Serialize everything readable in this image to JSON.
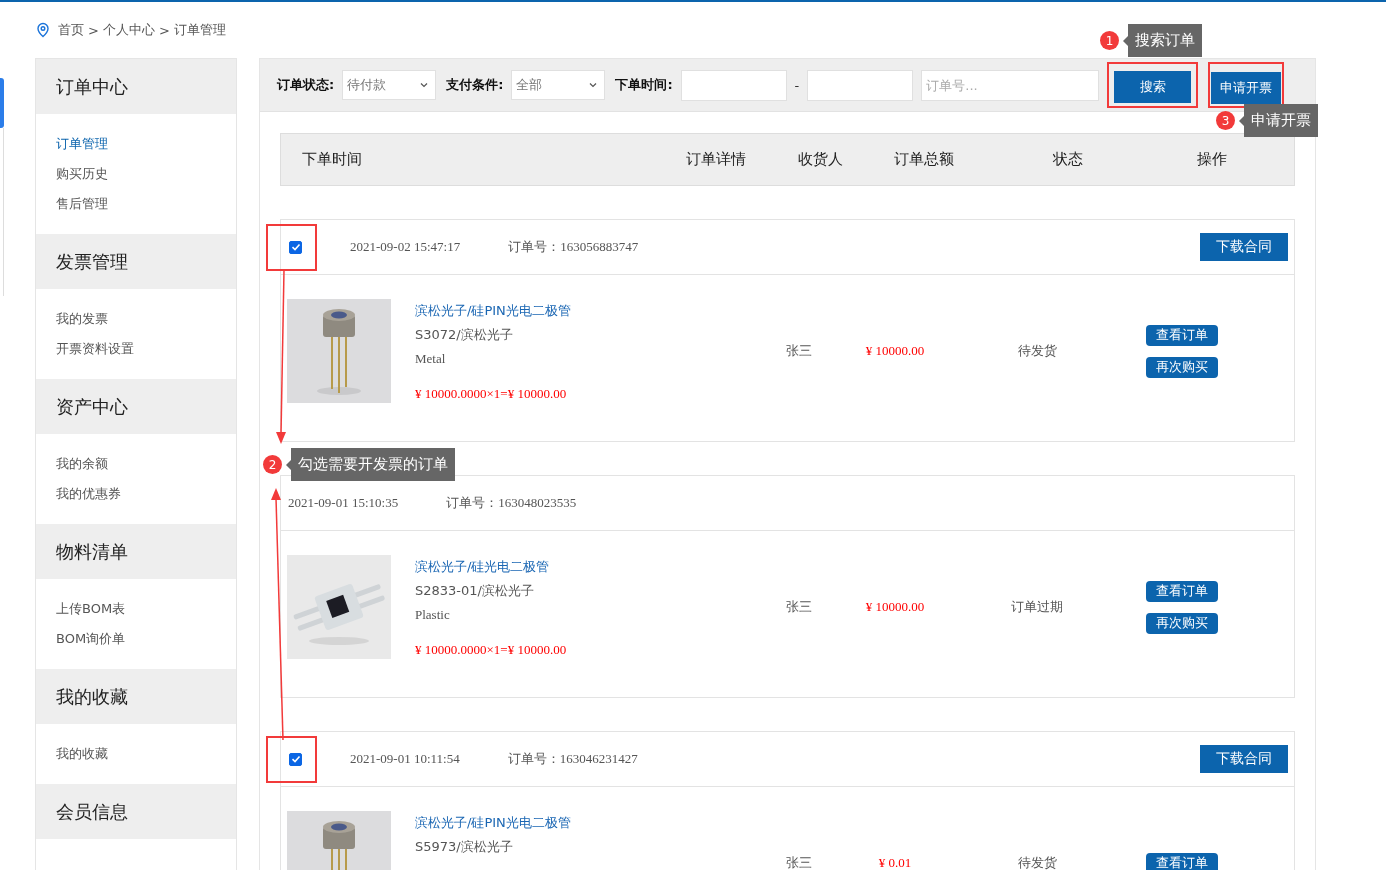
{
  "breadcrumb": {
    "separator": ">",
    "items": [
      "首页",
      "个人中心",
      "订单管理"
    ]
  },
  "sidebar": {
    "sections": [
      {
        "title": "订单中心",
        "items": [
          {
            "label": "订单管理",
            "selected": true
          },
          {
            "label": "购买历史",
            "selected": false
          },
          {
            "label": "售后管理",
            "selected": false
          }
        ]
      },
      {
        "title": "发票管理",
        "items": [
          {
            "label": "我的发票",
            "selected": false
          },
          {
            "label": "开票资料设置",
            "selected": false
          }
        ]
      },
      {
        "title": "资产中心",
        "items": [
          {
            "label": "我的余额",
            "selected": false
          },
          {
            "label": "我的优惠券",
            "selected": false
          }
        ]
      },
      {
        "title": "物料清单",
        "items": [
          {
            "label": "上传BOM表",
            "selected": false
          },
          {
            "label": "BOM询价单",
            "selected": false
          }
        ]
      },
      {
        "title": "我的收藏",
        "items": [
          {
            "label": "我的收藏",
            "selected": false
          }
        ]
      },
      {
        "title": "会员信息"
      }
    ]
  },
  "filters": [
    {
      "kind": "select",
      "label": "订单状态:",
      "value": "待付款"
    },
    {
      "kind": "select",
      "label": "支付条件:",
      "value": "全部"
    },
    {
      "kind": "daterange",
      "label": "下单时间:",
      "separator": "-"
    },
    {
      "kind": "text",
      "placeholder": "订单号..."
    }
  ],
  "search_button": {
    "label": "搜索",
    "highlighted": true
  },
  "apply_button": {
    "label": "申请开票",
    "highlighted": true
  },
  "columns": [
    "下单时间",
    "订单详情",
    "收货人",
    "订单总额",
    "状态",
    "操作"
  ],
  "orders": [
    {
      "checkbox": {
        "checked": true,
        "highlighted": true
      },
      "time": "2021-09-02 15:47:17",
      "order_no_label": "订单号：",
      "order_no": "163056883747",
      "download_button": "下载合同",
      "product": {
        "name": "滨松光子/硅PIN光电二极管",
        "model": "S3072/滨松光子",
        "material": "Metal",
        "price_line": "¥ 10000.0000×1=¥ 10000.00"
      },
      "receiver": "张三",
      "total": "¥ 10000.00",
      "status": "待发货",
      "actions": [
        "查看订单",
        "再次购买"
      ]
    },
    {
      "time": "2021-09-01 15:10:35",
      "order_no_label": "订单号：",
      "order_no": "163048023535",
      "product": {
        "name": "滨松光子/硅光电二极管",
        "model": "S2833-01/滨松光子",
        "material": "Plastic",
        "price_line": "¥ 10000.0000×1=¥ 10000.00"
      },
      "receiver": "张三",
      "total": "¥ 10000.00",
      "status": "订单过期",
      "actions": [
        "查看订单",
        "再次购买"
      ]
    },
    {
      "checkbox": {
        "checked": true,
        "highlighted": true
      },
      "time": "2021-09-01 10:11:54",
      "order_no_label": "订单号：",
      "order_no": "163046231427",
      "download_button": "下载合同",
      "product": {
        "name": "滨松光子/硅PIN光电二极管",
        "model": "S5973/滨松光子"
      },
      "receiver": "张三",
      "total": "¥ 0.01",
      "status": "待发货",
      "actions": [
        "查看订单"
      ]
    }
  ],
  "annotations": [
    {
      "number": "1",
      "text": "搜索订单"
    },
    {
      "number": "2",
      "text": "勾选需要开发票的订单"
    },
    {
      "number": "3",
      "text": "申请开票"
    }
  ]
}
